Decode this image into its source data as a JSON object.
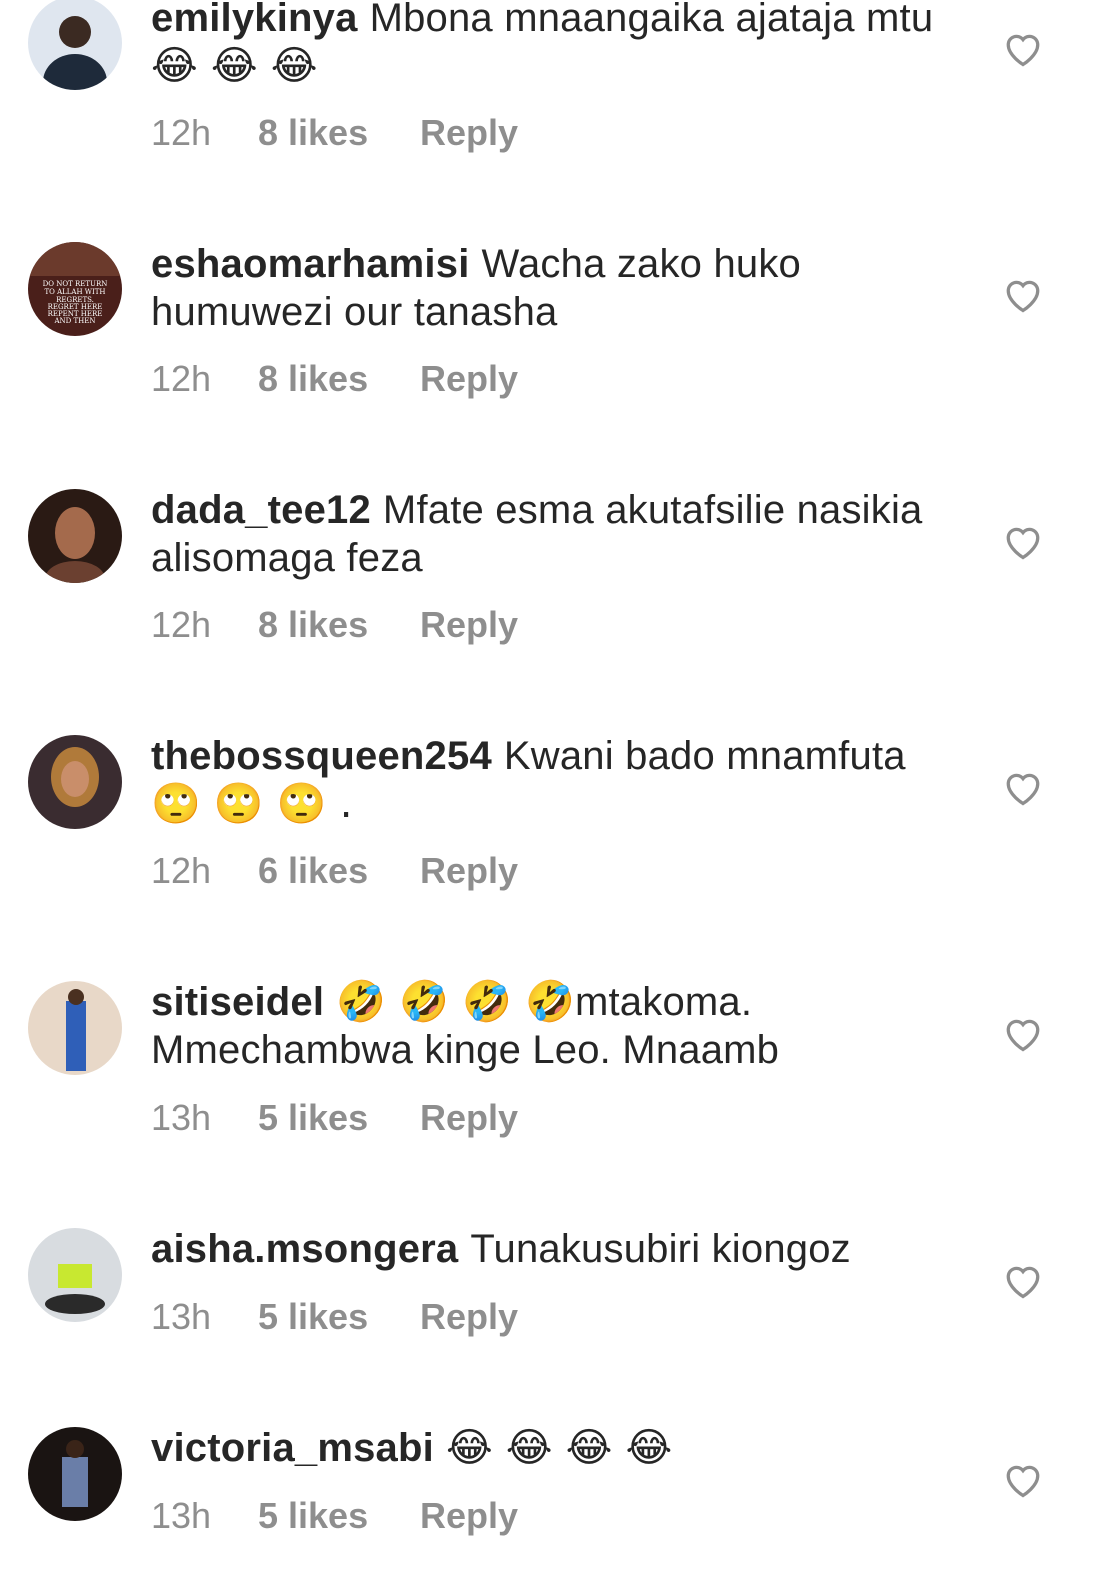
{
  "comments": [
    {
      "username": "emilykinya",
      "text": "Mbona mnaangaika ajataja mtu",
      "emoji": "😂 😂 😂",
      "time": "12h",
      "likes": "8 likes",
      "reply": "Reply"
    },
    {
      "username": "eshaomarhamisi",
      "text": "Wacha zako huko humuwezi our tanasha",
      "emoji": "",
      "time": "12h",
      "likes": "8 likes",
      "reply": "Reply",
      "avatar_text": "DO NOT RETURN TO ALLAH WITH REGRETS. REGRET HERE REPENT HERE AND THEN RETURN TO ALLAH."
    },
    {
      "username": "dada_tee12",
      "text": "Mfate esma akutafsilie nasikia alisomaga feza",
      "emoji": "",
      "time": "12h",
      "likes": "8 likes",
      "reply": "Reply"
    },
    {
      "username": "thebossqueen254",
      "text": "Kwani bado mnamfuta",
      "emoji": "🙄 🙄 🙄 .",
      "time": "12h",
      "likes": "6 likes",
      "reply": "Reply"
    },
    {
      "username": "sitiseidel",
      "text_before": "🤣 🤣 🤣 🤣",
      "text": "mtakoma. Mmechambwa kinge Leo. Mnaamb",
      "emoji": "",
      "time": "13h",
      "likes": "5 likes",
      "reply": "Reply"
    },
    {
      "username": "aisha.msongera",
      "text": "Tunakusubiri kiongoz",
      "emoji": "",
      "time": "13h",
      "likes": "5 likes",
      "reply": "Reply"
    },
    {
      "username": "victoria_msabi",
      "text": "",
      "emoji": "😂 😂 😂 😂",
      "time": "13h",
      "likes": "5 likes",
      "reply": "Reply"
    }
  ],
  "icons": {
    "like": "heart-outline-icon"
  },
  "colors": {
    "text": "#262626",
    "meta": "#8e8e8e",
    "background": "#ffffff"
  }
}
